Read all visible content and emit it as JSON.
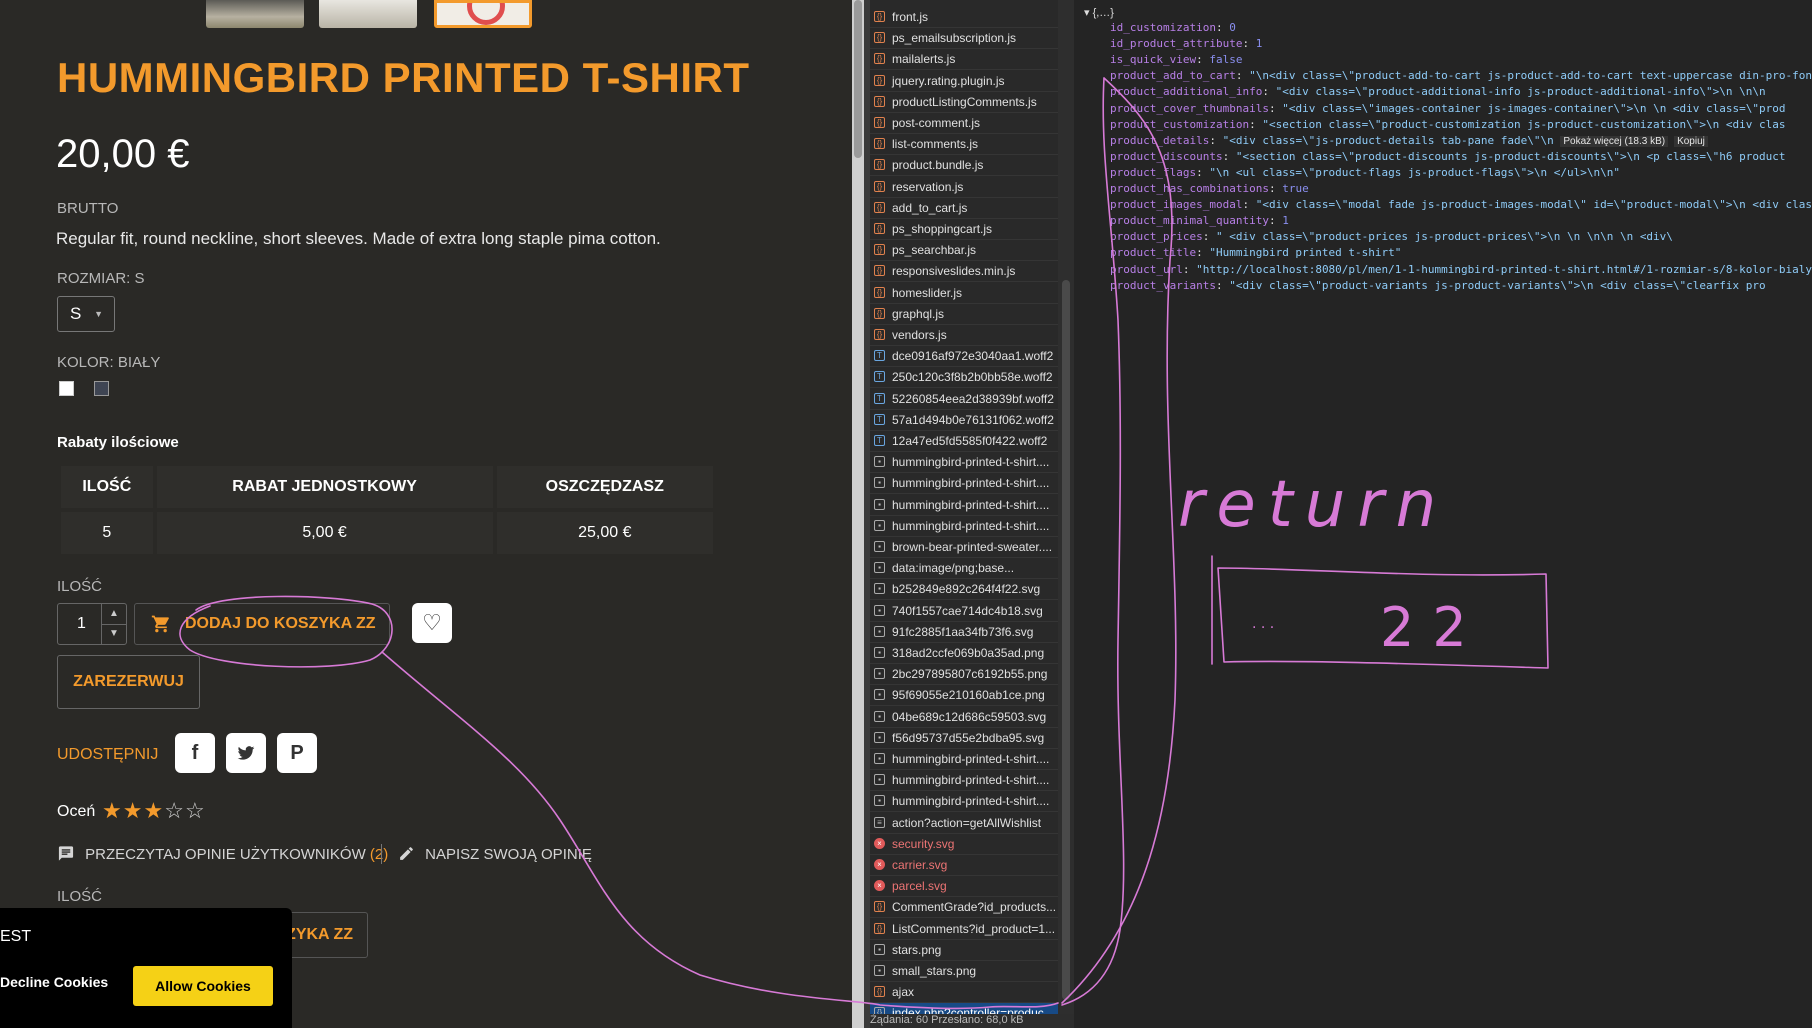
{
  "shop": {
    "product_title": "HUMMINGBIRD PRINTED T-SHIRT",
    "price": "20,00 €",
    "tax_label": "BRUTTO",
    "description": "Regular fit, round neckline, short sleeves. Made of extra long staple pima cotton.",
    "size_label": "ROZMIAR: S",
    "size_value": "S",
    "color_label": "KOLOR: BIAŁY",
    "colors": [
      "#ffffff",
      "#3f4553"
    ],
    "discounts_heading": "Rabaty ilościowe",
    "discount_table": {
      "headers": [
        "ILOŚĆ",
        "RABAT JEDNOSTKOWY",
        "OSZCZĘDZASZ"
      ],
      "rows": [
        [
          "5",
          "5,00 €",
          "25,00 €"
        ]
      ]
    },
    "quantity_label": "ILOŚĆ",
    "quantity_value": "1",
    "add_to_cart_label": "DODAJ DO KOSZYKA ZZ",
    "reserve_label": "ZAREZERWUJ",
    "share_label": "UDOSTĘPNIJ",
    "rate_label": "Oceń",
    "rating": 3,
    "rating_max": 5,
    "read_reviews_label": "PRZECZYTAJ OPINIE UŻYTKOWNIKÓW",
    "review_count": "(2)",
    "write_review_label": "NAPISZ SWOJĄ OPINIĘ",
    "quantity_label_2": "ILOŚĆ",
    "add_to_cart_label_2": "ZYKA ZZ",
    "accent_color": "#f39a2c"
  },
  "cookies": {
    "text": "EST",
    "decline_label": "Decline Cookies",
    "allow_label": "Allow Cookies"
  },
  "network": {
    "requests": [
      {
        "name": "front.js",
        "type": "js"
      },
      {
        "name": "ps_emailsubscription.js",
        "type": "js"
      },
      {
        "name": "mailalerts.js",
        "type": "js"
      },
      {
        "name": "jquery.rating.plugin.js",
        "type": "js"
      },
      {
        "name": "productListingComments.js",
        "type": "js"
      },
      {
        "name": "post-comment.js",
        "type": "js"
      },
      {
        "name": "list-comments.js",
        "type": "js"
      },
      {
        "name": "product.bundle.js",
        "type": "js"
      },
      {
        "name": "reservation.js",
        "type": "js"
      },
      {
        "name": "add_to_cart.js",
        "type": "js"
      },
      {
        "name": "ps_shoppingcart.js",
        "type": "js"
      },
      {
        "name": "ps_searchbar.js",
        "type": "js"
      },
      {
        "name": "responsiveslides.min.js",
        "type": "js"
      },
      {
        "name": "homeslider.js",
        "type": "js"
      },
      {
        "name": "graphql.js",
        "type": "js"
      },
      {
        "name": "vendors.js",
        "type": "js"
      },
      {
        "name": "dce0916af972e3040aa1.woff2",
        "type": "font"
      },
      {
        "name": "250c120c3f8b2b0bb58e.woff2",
        "type": "font"
      },
      {
        "name": "52260854eea2d38939bf.woff2",
        "type": "font"
      },
      {
        "name": "57a1d494b0e76131f062.woff2",
        "type": "font"
      },
      {
        "name": "12a47ed5fd5585f0f422.woff2",
        "type": "font"
      },
      {
        "name": "hummingbird-printed-t-shirt....",
        "type": "img"
      },
      {
        "name": "hummingbird-printed-t-shirt....",
        "type": "img"
      },
      {
        "name": "hummingbird-printed-t-shirt....",
        "type": "img"
      },
      {
        "name": "hummingbird-printed-t-shirt....",
        "type": "img"
      },
      {
        "name": "brown-bear-printed-sweater....",
        "type": "img"
      },
      {
        "name": "data:image/png;base...",
        "type": "img"
      },
      {
        "name": "b252849e892c264f4f22.svg",
        "type": "img"
      },
      {
        "name": "740f1557cae714dc4b18.svg",
        "type": "img"
      },
      {
        "name": "91fc2885f1aa34fb73f6.svg",
        "type": "img"
      },
      {
        "name": "318ad2ccfe069b0a35ad.png",
        "type": "img"
      },
      {
        "name": "2bc297895807c6192b55.png",
        "type": "img"
      },
      {
        "name": "95f69055e210160ab1ce.png",
        "type": "img"
      },
      {
        "name": "04be689c12d686c59503.svg",
        "type": "img"
      },
      {
        "name": "f56d95737d55e2bdba95.svg",
        "type": "img"
      },
      {
        "name": "hummingbird-printed-t-shirt....",
        "type": "img"
      },
      {
        "name": "hummingbird-printed-t-shirt....",
        "type": "img"
      },
      {
        "name": "hummingbird-printed-t-shirt....",
        "type": "img"
      },
      {
        "name": "action?action=getAllWishlist",
        "type": "doc"
      },
      {
        "name": "security.svg",
        "type": "err"
      },
      {
        "name": "carrier.svg",
        "type": "err"
      },
      {
        "name": "parcel.svg",
        "type": "err"
      },
      {
        "name": "CommentGrade?id_products...",
        "type": "js"
      },
      {
        "name": "ListComments?id_product=1...",
        "type": "js"
      },
      {
        "name": "stars.png",
        "type": "img"
      },
      {
        "name": "small_stars.png",
        "type": "img"
      },
      {
        "name": "ajax",
        "type": "js"
      },
      {
        "name": "index.php?controller=produc...",
        "type": "sel"
      }
    ],
    "footer": "Żądania: 60   Przesłano: 68,0 kB"
  },
  "preview": {
    "root": "▾ {,…}",
    "properties": [
      {
        "key": "id_customization",
        "value": "0",
        "kind": "n"
      },
      {
        "key": "id_product_attribute",
        "value": "1",
        "kind": "n"
      },
      {
        "key": "is_quick_view",
        "value": "false",
        "kind": "n"
      },
      {
        "key": "product_add_to_cart",
        "value": "\"\\n<div class=\\\"product-add-to-cart js-product-add-to-cart text-uppercase din-pro-font",
        "kind": "s"
      },
      {
        "key": "product_additional_info",
        "value": "\"<div class=\\\"product-additional-info js-product-additional-info\\\">\\n  \\n\\n",
        "kind": "s"
      },
      {
        "key": "product_cover_thumbnails",
        "value": "\"<div class=\\\"images-container js-images-container\\\">\\n  \\n    <div class=\\\"prod",
        "kind": "s"
      },
      {
        "key": "product_customization",
        "value": "\"<section class=\\\"product-customization js-product-customization\\\">\\n      <div clas",
        "kind": "s"
      },
      {
        "key": "product_details",
        "value": "\"<div class=\\\"js-product-details tab-pane fade\\\"\\n",
        "kind": "s",
        "more": "Pokaż więcej (18.3 kB)",
        "copy": "Kopiuj"
      },
      {
        "key": "product_discounts",
        "value": "\"<section class=\\\"product-discounts js-product-discounts\\\">\\n      <p class=\\\"h6 product",
        "kind": "s"
      },
      {
        "key": "product_flags",
        "value": "\"\\n    <ul class=\\\"product-flags js-product-flags\\\">\\n            </ul>\\n\\n\"",
        "kind": "s"
      },
      {
        "key": "product_has_combinations",
        "value": "true",
        "kind": "n"
      },
      {
        "key": "product_images_modal",
        "value": "\"<div class=\\\"modal fade js-product-images-modal\\\" id=\\\"product-modal\\\">\\n  <div clas",
        "kind": "s"
      },
      {
        "key": "product_minimal_quantity",
        "value": "1",
        "kind": "n"
      },
      {
        "key": "product_prices",
        "value": "\"  <div class=\\\"product-prices js-product-prices\\\">\\n    \\n          \\n\\n    \\n      <div\\",
        "kind": "s"
      },
      {
        "key": "product_title",
        "value": "\"Hummingbird printed t-shirt\"",
        "kind": "s"
      },
      {
        "key": "product_url",
        "value": "\"http://localhost:8080/pl/men/1-1-hummingbird-printed-t-shirt.html#/1-rozmiar-s/8-kolor-bialy\"",
        "kind": "s"
      },
      {
        "key": "product_variants",
        "value": "\"<div class=\\\"product-variants js-product-variants\\\">\\n          <div class=\\\"clearfix pro",
        "kind": "s"
      }
    ]
  },
  "annotation": {
    "handwritten_word": "return",
    "handwritten_box_text": "22",
    "ink_color": "#d77ad6"
  }
}
